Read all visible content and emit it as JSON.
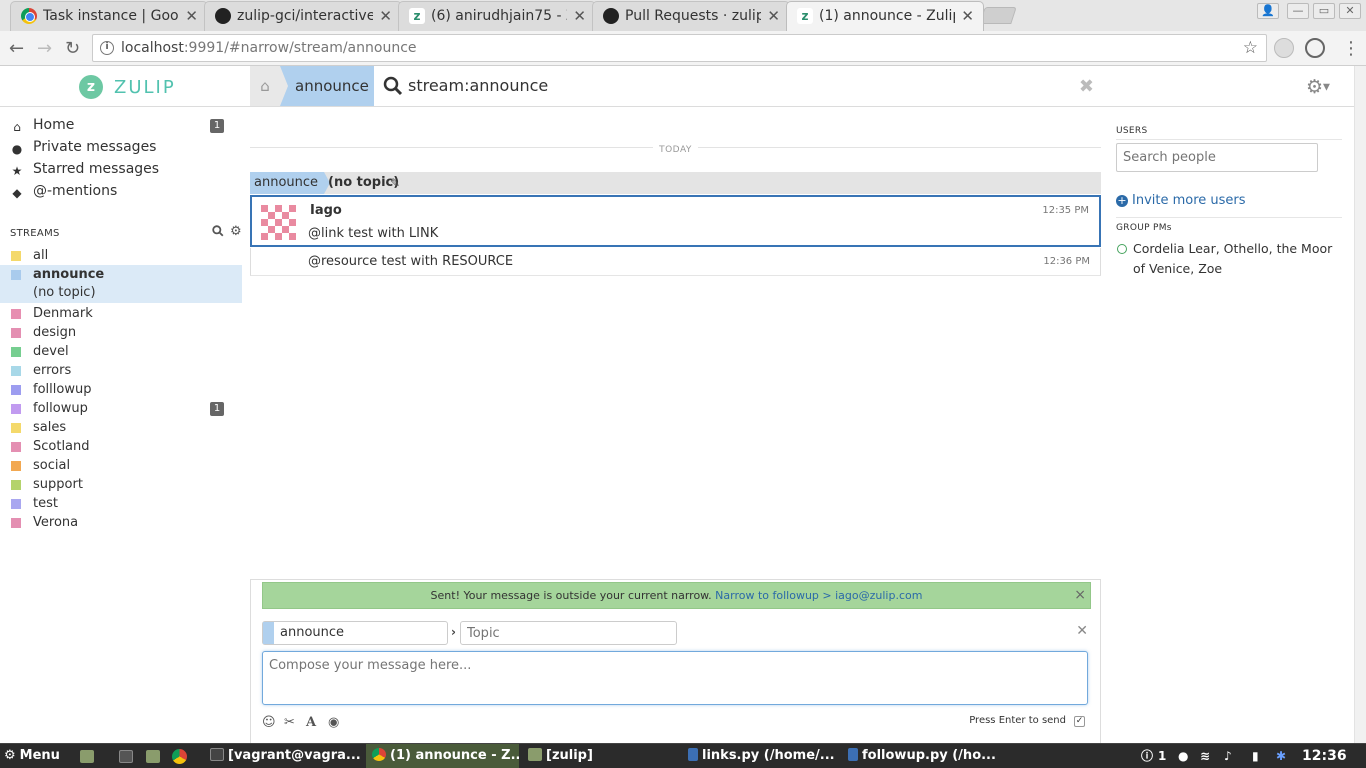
{
  "browser": {
    "tabs": [
      {
        "title": "Task instance | Goo",
        "favicon": "google-icon"
      },
      {
        "title": "zulip-gci/interactive",
        "favicon": "github-icon"
      },
      {
        "title": "(6) anirudhjain75 - Z",
        "favicon": "zulip-icon"
      },
      {
        "title": "Pull Requests · zulip",
        "favicon": "github-icon"
      },
      {
        "title": "(1) announce - Zulip",
        "favicon": "zulip-icon"
      }
    ],
    "url_host": "localhost",
    "url_rest": ":9991/#narrow/stream/announce"
  },
  "header": {
    "brand": "ZULIP",
    "stream_crumb": "announce",
    "search_query": "stream:announce"
  },
  "sidebar": {
    "nav": [
      {
        "label": "Home",
        "icon": "home-icon",
        "badge": "1"
      },
      {
        "label": "Private messages",
        "icon": "user-icon",
        "badge": ""
      },
      {
        "label": "Starred messages",
        "icon": "star-icon",
        "badge": ""
      },
      {
        "label": "@-mentions",
        "icon": "tag-icon",
        "badge": ""
      }
    ],
    "streams_header": "STREAMS",
    "streams": [
      {
        "name": "all",
        "color": "#f4d96b",
        "badge": ""
      },
      {
        "name": "announce",
        "color": "#a9cbed",
        "badge": ""
      },
      {
        "name": "Denmark",
        "color": "#e78fb1",
        "badge": ""
      },
      {
        "name": "design",
        "color": "#e48fb2",
        "badge": ""
      },
      {
        "name": "devel",
        "color": "#76ce90",
        "badge": ""
      },
      {
        "name": "errors",
        "color": "#a8d8e8",
        "badge": ""
      },
      {
        "name": "folllowup",
        "color": "#9d9df0",
        "badge": ""
      },
      {
        "name": "followup",
        "color": "#c19bf0",
        "badge": "1"
      },
      {
        "name": "sales",
        "color": "#f4d96b",
        "badge": ""
      },
      {
        "name": "Scotland",
        "color": "#e48fb2",
        "badge": ""
      },
      {
        "name": "social",
        "color": "#f2a851",
        "badge": ""
      },
      {
        "name": "support",
        "color": "#b4d36c",
        "badge": ""
      },
      {
        "name": "test",
        "color": "#a9a7f0",
        "badge": ""
      },
      {
        "name": "Verona",
        "color": "#e48fb2",
        "badge": ""
      }
    ],
    "active_topic": "(no topic)"
  },
  "messages": {
    "date_divider": "TODAY",
    "recipient_stream": "announce",
    "recipient_topic": "(no topic)",
    "items": [
      {
        "sender": "Iago",
        "text": "@link test with LINK",
        "time": "12:35 PM"
      },
      {
        "sender": "",
        "text": "@resource test with RESOURCE",
        "time": "12:36 PM"
      }
    ]
  },
  "compose": {
    "banner_text": "Sent! Your message is outside your current narrow.",
    "banner_link": "Narrow to followup > iago@zulip.com",
    "stream_value": "announce",
    "topic_placeholder": "Topic",
    "message_placeholder": "Compose your message here...",
    "enter_label": "Press Enter to send"
  },
  "right_sidebar": {
    "users_header": "USERS",
    "search_placeholder": "Search people",
    "invite_label": "Invite more users",
    "group_pms_header": "GROUP PMs",
    "group_pm": "Cordelia Lear, Othello, the Moor of Venice, Zoe"
  },
  "taskbar": {
    "menu": "Menu",
    "windows": [
      "[vagrant@vagra...",
      "(1) announce - Z...",
      "[zulip]",
      "links.py (/home/...",
      "followup.py (/ho..."
    ],
    "notif_count": "1",
    "clock": "12:36"
  },
  "colors": {
    "accent": "#3874b5",
    "stream_announce": "#b0d0ee",
    "success": "#a5d59b"
  }
}
